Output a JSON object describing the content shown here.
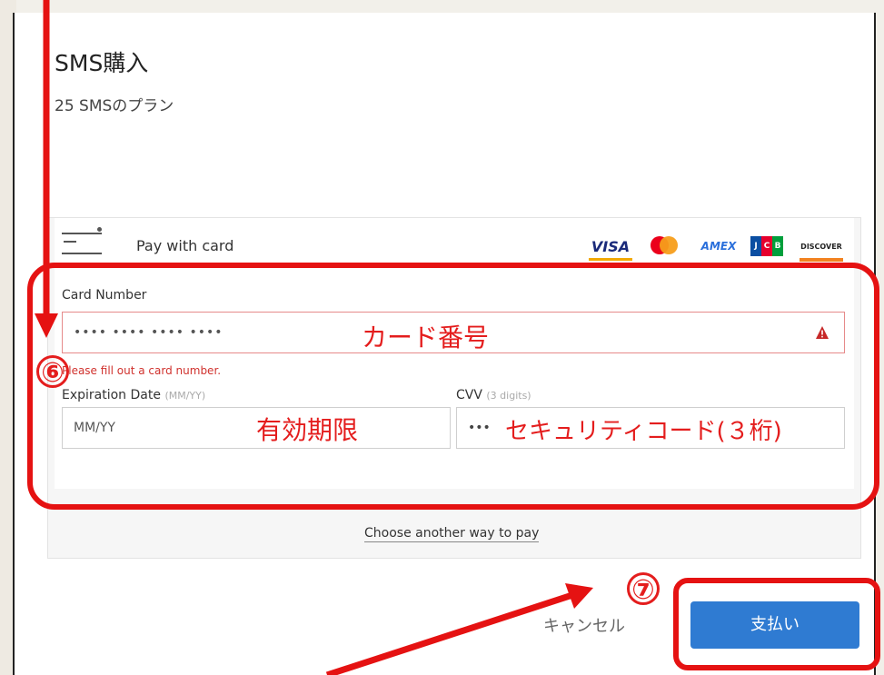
{
  "dialog": {
    "title": "SMS購入",
    "subtitle": "25 SMSのプラン"
  },
  "payment": {
    "header_label": "Pay with card",
    "brands": [
      "VISA",
      "MasterCard",
      "AMEX",
      "JCB",
      "DISCOVER"
    ],
    "card_number": {
      "label": "Card Number",
      "placeholder": "•••• •••• •••• ••••",
      "error": "Please fill out a card number."
    },
    "expiration": {
      "label": "Expiration Date",
      "hint": "(MM/YY)",
      "placeholder": "MM/YY"
    },
    "cvv": {
      "label": "CVV",
      "hint": "(3 digits)",
      "placeholder": "•••"
    },
    "alternate_link": "Choose another way to pay"
  },
  "actions": {
    "cancel_label": "キャンセル",
    "pay_label": "支払い"
  },
  "annotations": {
    "card_number_note": "カード番号",
    "expiration_note": "有効期限",
    "cvv_note": "セキュリティコード(３桁)",
    "step6": "⑥",
    "step7": "⑦"
  },
  "colors": {
    "annotation_red": "#e51212",
    "pay_button_blue": "#2f7bd2",
    "error_red": "#d0312d"
  }
}
